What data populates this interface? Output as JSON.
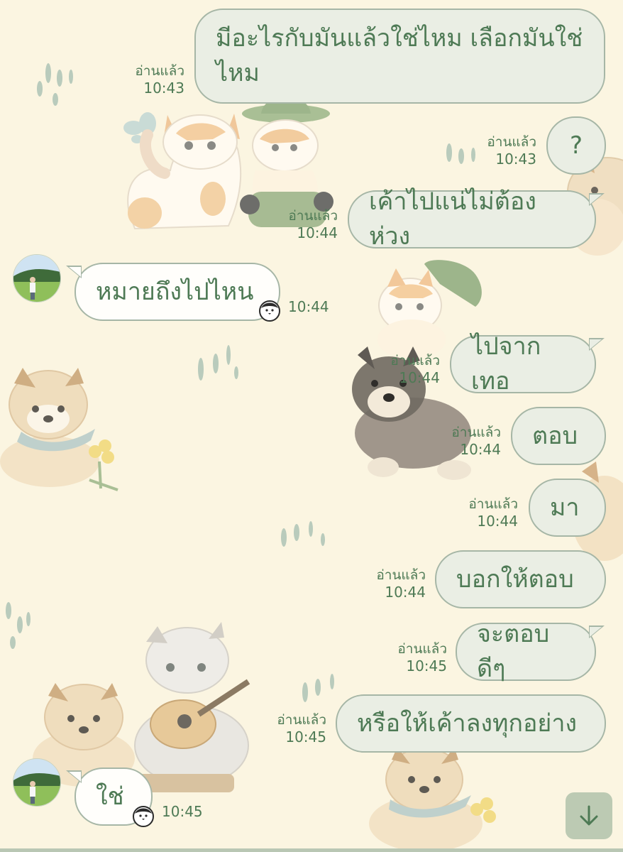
{
  "chat": {
    "messages": [
      {
        "text": "มีอะไรกับมันแล้วใช่ไหม เลือกมันใช่ไหม",
        "line1": "มีอะไรกับมันแล้วใช่ไหม เลือกมันใช่",
        "line2": "ไหม",
        "read": "อ่านแล้ว",
        "time": "10:43"
      },
      {
        "text": "?",
        "read": "อ่านแล้ว",
        "time": "10:43"
      },
      {
        "text": "เค้าไปแน่ไม่ต้องห่วง",
        "read": "อ่านแล้ว",
        "time": "10:44"
      },
      {
        "text": "หมายถึงไปไหน",
        "time": "10:44"
      },
      {
        "text": "ไปจากเทอ",
        "read": "อ่านแล้ว",
        "time": "10:44"
      },
      {
        "text": "ตอบ",
        "read": "อ่านแล้ว",
        "time": "10:44"
      },
      {
        "text": "มา",
        "read": "อ่านแล้ว",
        "time": "10:44"
      },
      {
        "text": "บอกให้ตอบ",
        "read": "อ่านแล้ว",
        "time": "10:44"
      },
      {
        "text": "จะตอบดีๆ",
        "read": "อ่านแล้ว",
        "time": "10:45"
      },
      {
        "text": "หรือให้เค้าลงทุกอย่าง",
        "read": "อ่านแล้ว",
        "time": "10:45"
      },
      {
        "text": "ใช่",
        "time": "10:45"
      }
    ]
  },
  "icons": {
    "avatar": "avatar-photo",
    "sticker": "penguin-icon",
    "scroll": "arrow-down-icon"
  },
  "colors": {
    "background": "#fbf5e1",
    "text": "#4e7a55",
    "outgoing_bubble": "#eaeee4",
    "incoming_bubble": "#fffefb",
    "border": "#a6b6a6"
  }
}
